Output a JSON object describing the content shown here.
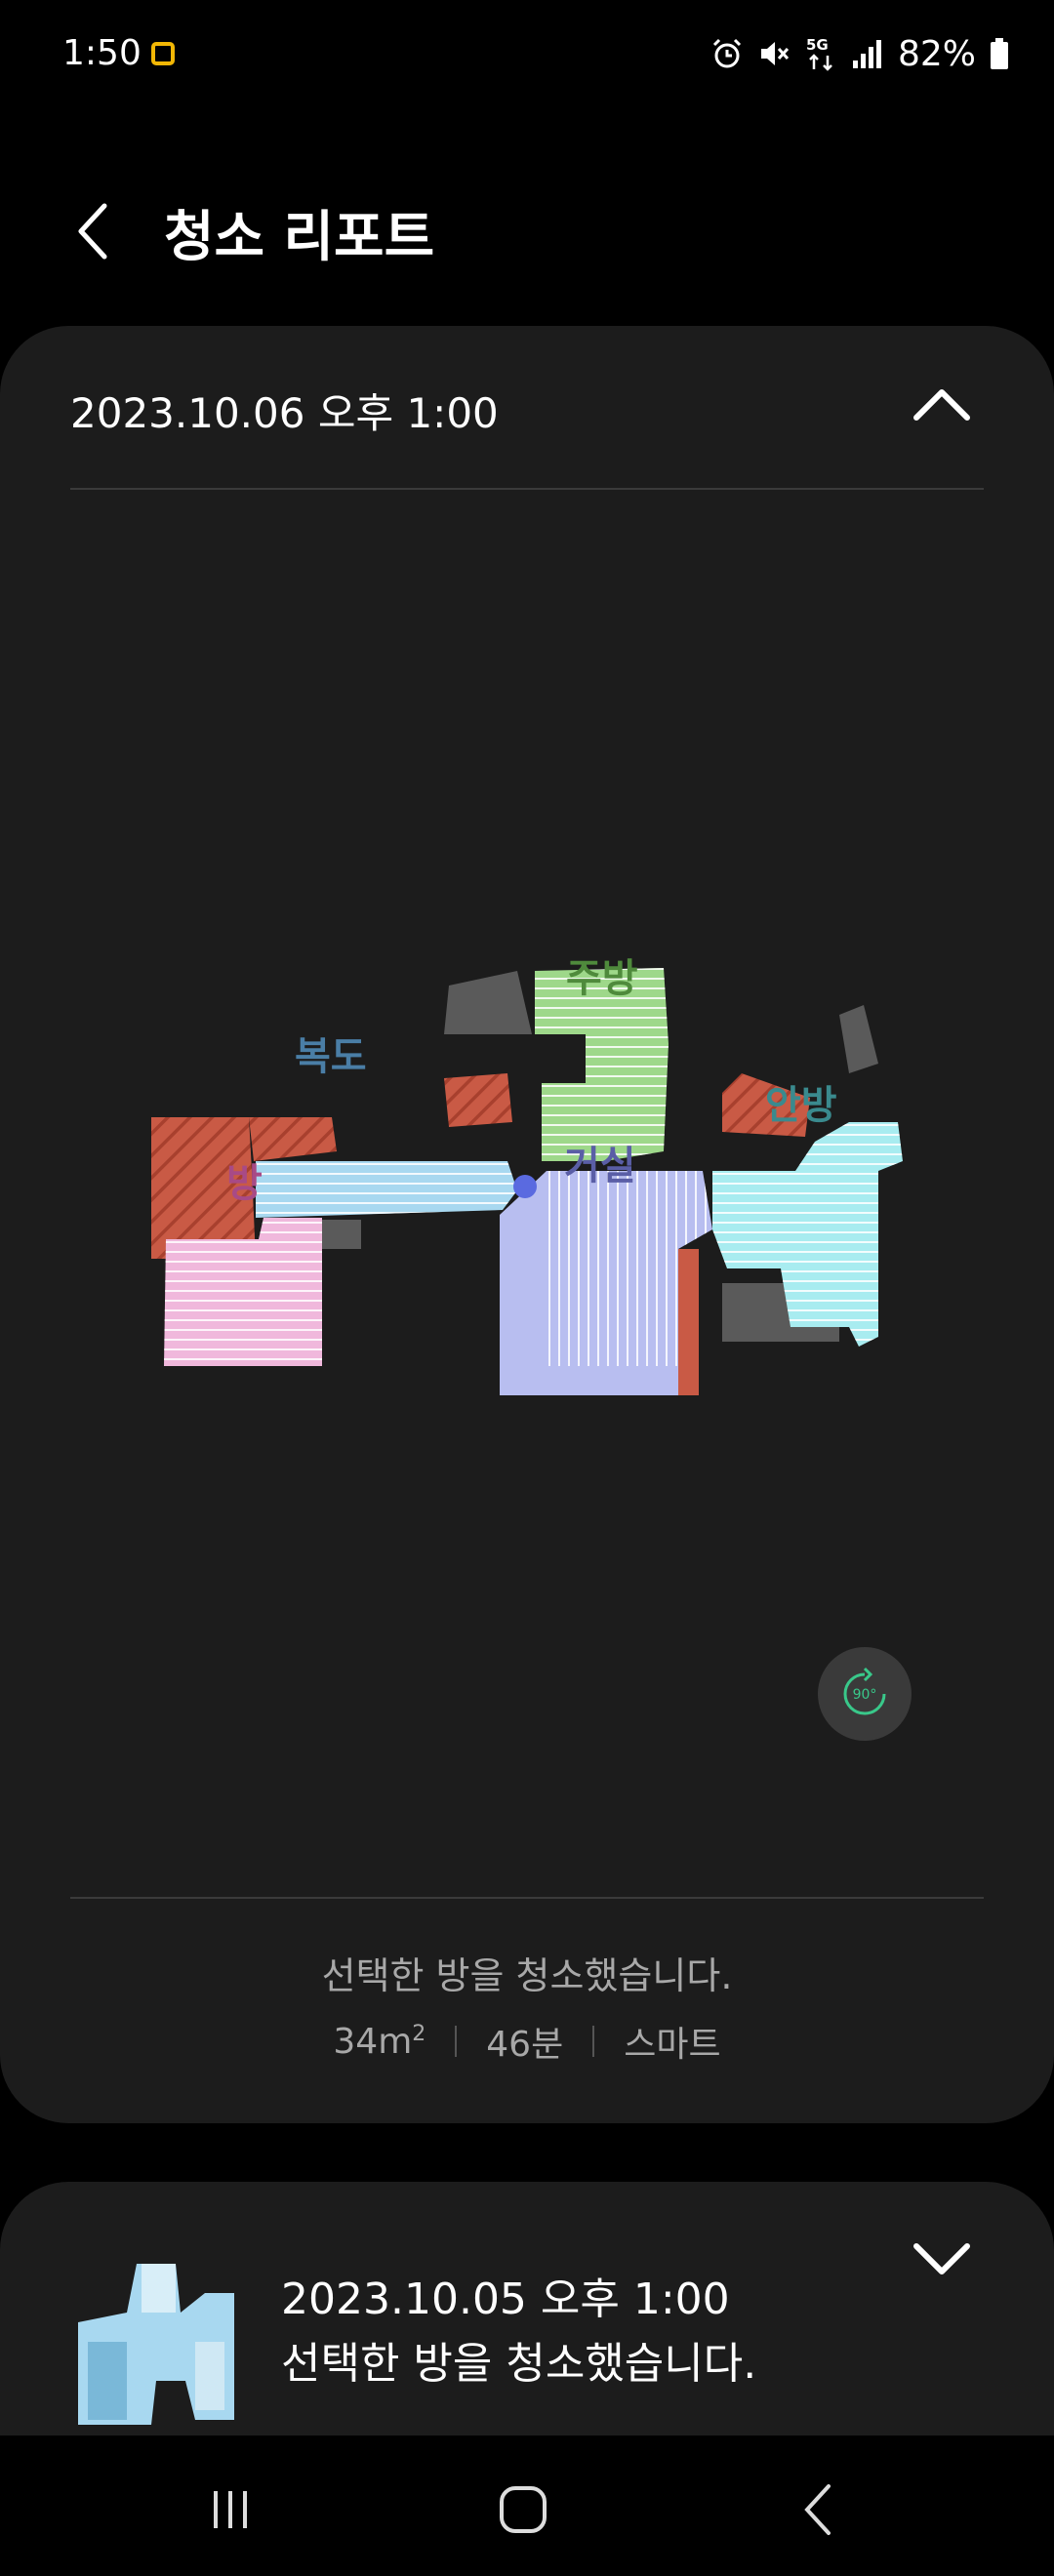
{
  "status_bar": {
    "time": "1:50",
    "battery_text": "82%",
    "icons": [
      "notification-icon",
      "alarm-icon",
      "mute-icon",
      "5g-icon",
      "signal-icon",
      "battery-icon"
    ]
  },
  "header": {
    "title": "청소 리포트"
  },
  "report": {
    "date": "2023.10.06 오후 1:00",
    "summary": "선택한 방을 청소했습니다.",
    "area_value": "34m",
    "area_sup": "2",
    "duration": "46분",
    "mode": "스마트",
    "rotate_label": "90°",
    "rooms": {
      "kitchen": "주방",
      "hallway": "복도",
      "room": "방",
      "living": "거실",
      "bedroom": "안방"
    }
  },
  "previous_report": {
    "date": "2023.10.05 오후 1:00",
    "summary": "선택한 방을 청소했습니다."
  },
  "colors": {
    "background": "#000000",
    "card": "#1c1c1c",
    "kitchen": "#9ed88a",
    "hallway": "#a8d8f0",
    "room": "#f0b8dc",
    "living": "#b8bef0",
    "bedroom": "#a8ecf0",
    "no_go": "#c95a45",
    "accent_green": "#39c88a"
  }
}
